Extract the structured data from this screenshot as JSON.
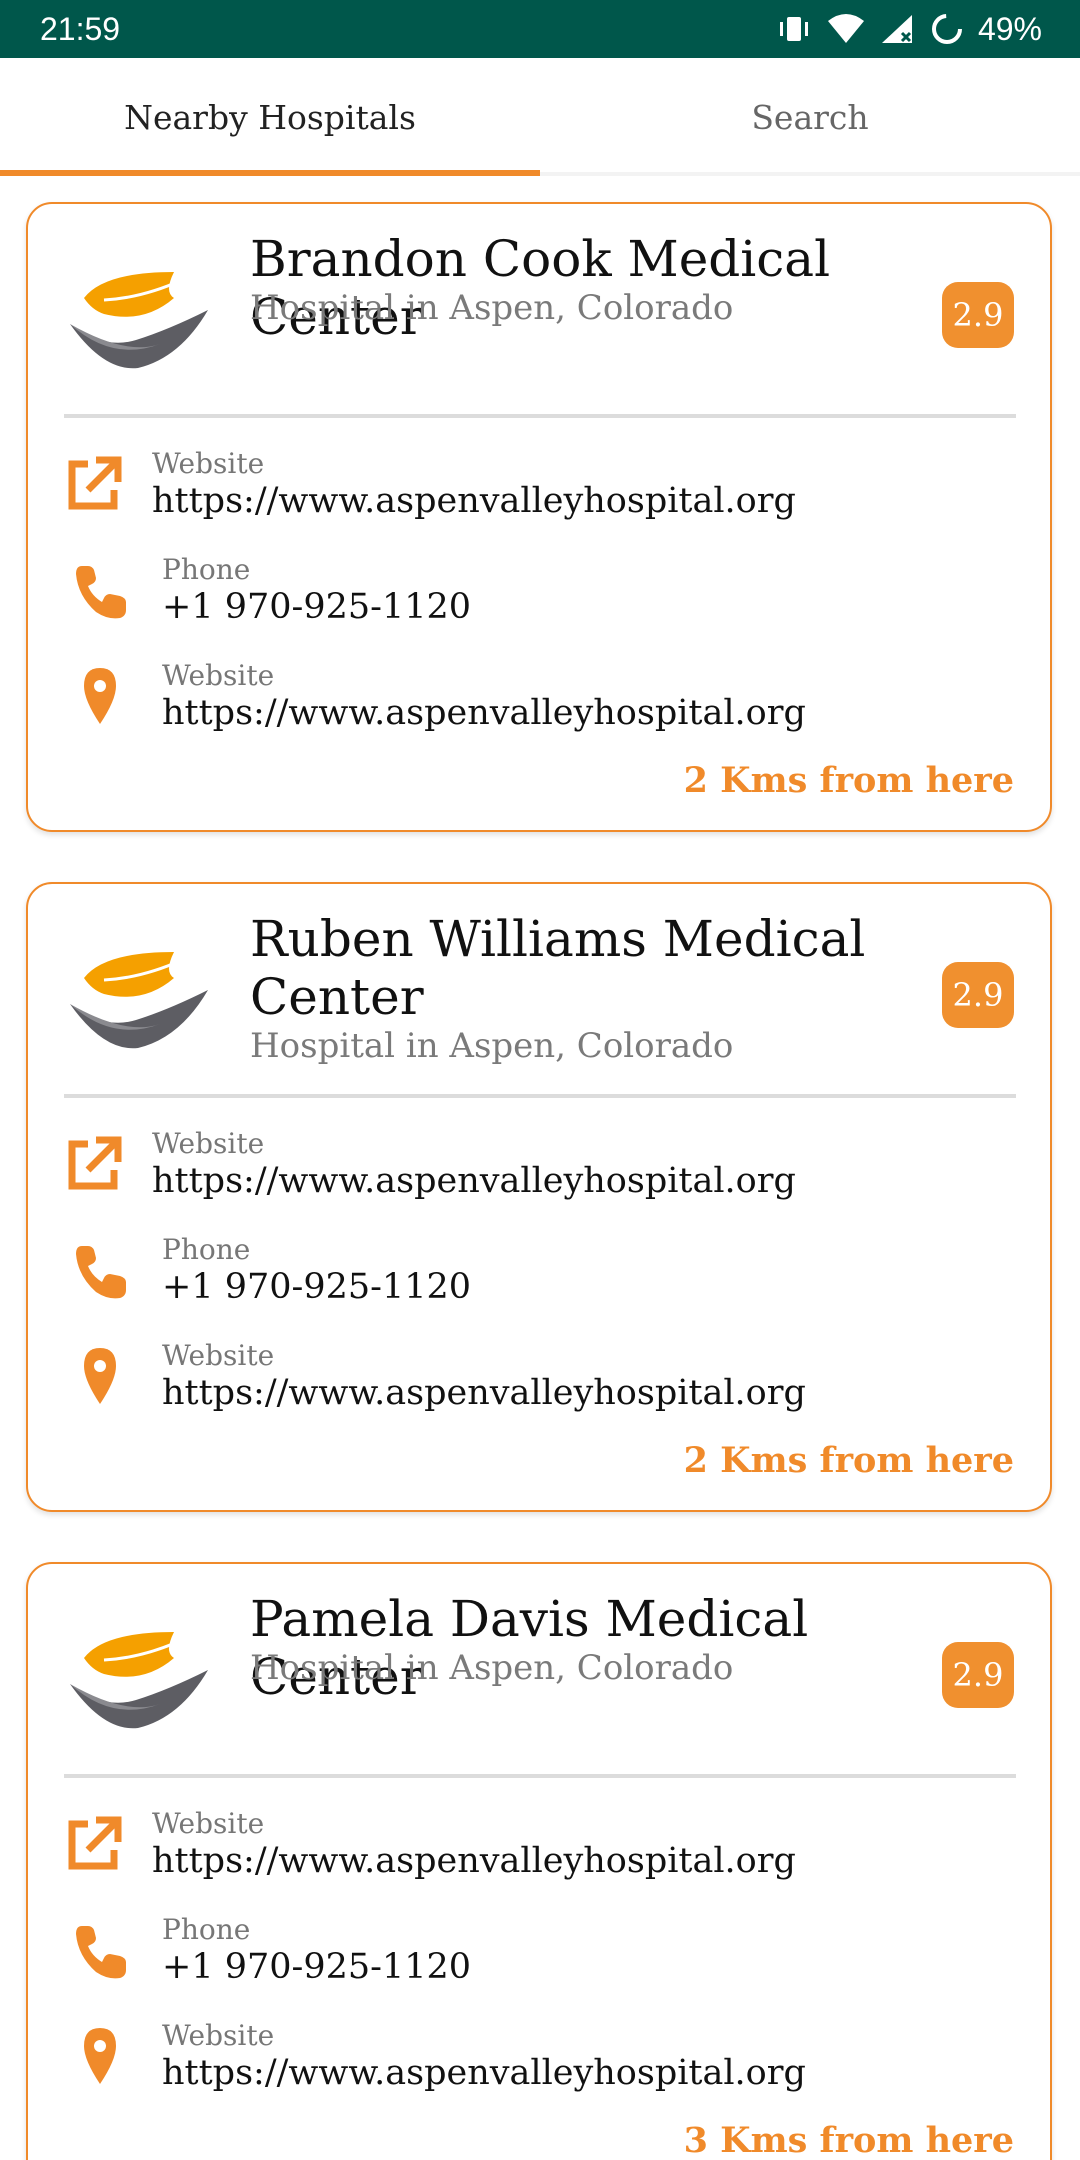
{
  "status_bar": {
    "time": "21:59",
    "battery": "49%"
  },
  "tabs": [
    {
      "label": "Nearby Hospitals",
      "active": true
    },
    {
      "label": "Search",
      "active": false
    }
  ],
  "colors": {
    "accent": "#f08a2a",
    "status_bar": "#00574b",
    "badge": "#f0902f"
  },
  "hospitals": [
    {
      "name": "Brandon Cook Medical Center",
      "subtitle": "Hospital in Aspen, Colorado",
      "rating": "2.9",
      "website_label": "Website",
      "website": "https://www.aspenvalleyhospital.org",
      "phone_label": "Phone",
      "phone": "+1 970-925-1120",
      "location_label": "Website",
      "location": "https://www.aspenvalleyhospital.org",
      "distance": "2 Kms from here"
    },
    {
      "name": "Ruben Williams Medical Center",
      "subtitle": "Hospital in Aspen, Colorado",
      "rating": "2.9",
      "website_label": "Website",
      "website": "https://www.aspenvalleyhospital.org",
      "phone_label": "Phone",
      "phone": "+1 970-925-1120",
      "location_label": "Website",
      "location": "https://www.aspenvalleyhospital.org",
      "distance": "2 Kms from here"
    },
    {
      "name": "Pamela Davis Medical Center",
      "subtitle": "Hospital in Aspen, Colorado",
      "rating": "2.9",
      "website_label": "Website",
      "website": "https://www.aspenvalleyhospital.org",
      "phone_label": "Phone",
      "phone": "+1 970-925-1120",
      "location_label": "Website",
      "location": "https://www.aspenvalleyhospital.org",
      "distance": "3 Kms from here"
    }
  ],
  "icons": {
    "logo": "hospital-logo-icon",
    "website": "open-external-icon",
    "phone": "phone-icon",
    "location": "location-pin-icon"
  }
}
